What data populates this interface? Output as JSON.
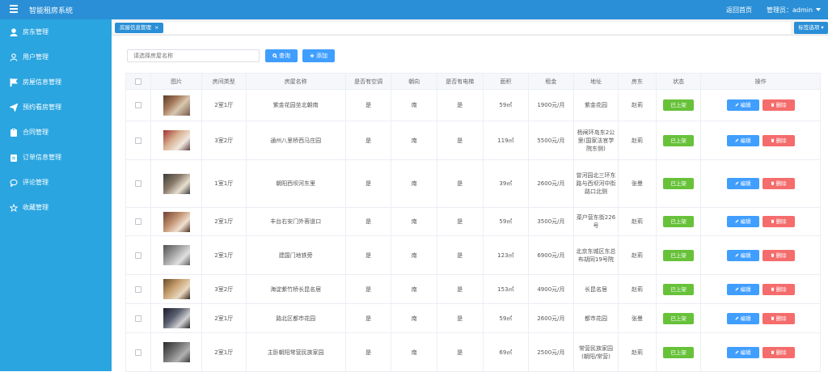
{
  "app": {
    "title": "智能租房系统",
    "home_link": "返回首页",
    "admin_label": "管理员：admin"
  },
  "sidebar": {
    "items": [
      {
        "label": "房东管理",
        "icon": "user-icon"
      },
      {
        "label": "用户管理",
        "icon": "user-outline-icon"
      },
      {
        "label": "房屋信息管理",
        "icon": "flag-icon"
      },
      {
        "label": "预约看房管理",
        "icon": "send-icon"
      },
      {
        "label": "合同管理",
        "icon": "clipboard-icon"
      },
      {
        "label": "订单信息管理",
        "icon": "clipboard-list-icon"
      },
      {
        "label": "评论管理",
        "icon": "chat-icon"
      },
      {
        "label": "收藏管理",
        "icon": "star-icon"
      }
    ]
  },
  "tabs": {
    "active": "房屋信息管理",
    "options_label": "标签选项"
  },
  "search": {
    "placeholder": "请选择房屋名称",
    "query_label": "查询",
    "add_label": "添加"
  },
  "table": {
    "headers": [
      "",
      "图片",
      "房间类型",
      "房屋名称",
      "是否有空调",
      "朝向",
      "是否有电梯",
      "面积",
      "租金",
      "地址",
      "房东",
      "状态",
      "操作"
    ],
    "status_label": "已上架",
    "edit_label": "编辑",
    "delete_label": "删除",
    "rows": [
      {
        "type": "2室1厅",
        "name": "紫金花园坐北朝南",
        "ac": "是",
        "orient": "南",
        "elevator": "是",
        "area": "59㎡",
        "rent": "1900元/月",
        "address": "紫金花园",
        "landlord": "赵莉"
      },
      {
        "type": "3室2厅",
        "name": "通州八里桥西马庄园",
        "ac": "是",
        "orient": "南",
        "elevator": "是",
        "area": "119㎡",
        "rent": "5500元/月",
        "address": "杨闸环岛东2公里(国家法官学院东侧)",
        "landlord": "赵莉"
      },
      {
        "type": "1室1厅",
        "name": "朝阳西坝河东里",
        "ac": "是",
        "orient": "南",
        "elevator": "是",
        "area": "39㎡",
        "rent": "2600元/月",
        "address": "曾河园北三环东路与西坝河中街路口北侧",
        "landlord": "张曼"
      },
      {
        "type": "2室1厅",
        "name": "丰台右安门外蓉道口",
        "ac": "是",
        "orient": "南",
        "elevator": "是",
        "area": "59㎡",
        "rent": "3500元/月",
        "address": "菜户营东街226号",
        "landlord": "赵莉"
      },
      {
        "type": "2室1厅",
        "name": "建国门地铁旁",
        "ac": "是",
        "orient": "南",
        "elevator": "是",
        "area": "123㎡",
        "rent": "6900元/月",
        "address": "北京东城区东总布胡同19号院",
        "landlord": "赵莉"
      },
      {
        "type": "3室2厅",
        "name": "海淀紫竹桥长昆名居",
        "ac": "是",
        "orient": "南",
        "elevator": "是",
        "area": "153㎡",
        "rent": "4900元/月",
        "address": "长昆名居",
        "landlord": "赵莉"
      },
      {
        "type": "2室1厅",
        "name": "路北区都市花园",
        "ac": "是",
        "orient": "南",
        "elevator": "是",
        "area": "59㎡",
        "rent": "2600元/月",
        "address": "都市花园",
        "landlord": "张曼"
      },
      {
        "type": "2室1厅",
        "name": "主卧朝阳常营民族家园",
        "ac": "是",
        "orient": "南",
        "elevator": "是",
        "area": "69㎡",
        "rent": "2500元/月",
        "address": "常营民族家园(朝阳/常营)",
        "landlord": "赵莉"
      }
    ]
  }
}
